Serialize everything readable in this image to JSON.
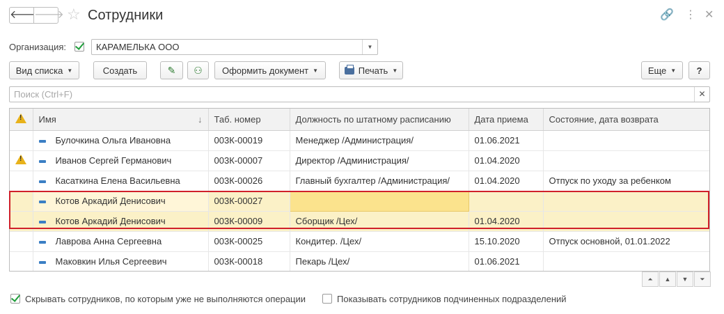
{
  "window": {
    "title": "Сотрудники",
    "back_icon": "arrow-left-icon",
    "forward_icon": "arrow-right-icon",
    "favorite_icon": "star-icon",
    "link_icon": "link-icon",
    "menu_icon": "more-vertical-icon",
    "close_icon": "close-icon"
  },
  "organization": {
    "label": "Организация:",
    "checked": true,
    "value": "КАРАМЕЛЬКА ООО"
  },
  "toolbar": {
    "view_list": "Вид списка",
    "create": "Создать",
    "document": "Оформить документ",
    "print": "Печать",
    "more": "Еще",
    "help": "?"
  },
  "search": {
    "placeholder": "Поиск (Ctrl+F)"
  },
  "table": {
    "columns": [
      "Имя",
      "Таб. номер",
      "Должность по штатному расписанию",
      "Дата приема",
      "Состояние, дата возврата"
    ],
    "rows": [
      {
        "warn": false,
        "name": "Булочкина Ольга Ивановна",
        "tab": "003К-00019",
        "position": "Менеджер /Администрация/",
        "date": "01.06.2021",
        "state": ""
      },
      {
        "warn": true,
        "name": "Иванов Сергей Германович",
        "tab": "003К-00007",
        "position": "Директор /Администрация/",
        "date": "01.04.2020",
        "state": ""
      },
      {
        "warn": false,
        "name": "Касаткина Елена Васильевна",
        "tab": "003К-00026",
        "position": "Главный бухгалтер /Администрация/",
        "date": "01.04.2020",
        "state": "Отпуск по уходу за ребенком"
      },
      {
        "warn": false,
        "name": "Котов Аркадий Денисович",
        "tab": "003К-00027",
        "position": "",
        "date": "",
        "state": ""
      },
      {
        "warn": false,
        "name": "Котов Аркадий Денисович",
        "tab": "003К-00009",
        "position": "Сборщик /Цех/",
        "date": "01.04.2020",
        "state": ""
      },
      {
        "warn": false,
        "name": "Лаврова Анна Сергеевна",
        "tab": "003К-00025",
        "position": "Кондитер. /Цех/",
        "date": "15.10.2020",
        "state": "Отпуск основной, 01.01.2022"
      },
      {
        "warn": false,
        "name": "Маковкин Илья Сергеевич",
        "tab": "003К-00018",
        "position": "Пекарь /Цех/",
        "date": "01.06.2021",
        "state": ""
      }
    ]
  },
  "footer": {
    "hide_label": "Скрывать сотрудников, по которым уже не выполняются операции",
    "hide_checked": true,
    "show_sub_label": "Показывать сотрудников подчиненных подразделений",
    "show_sub_checked": false
  }
}
